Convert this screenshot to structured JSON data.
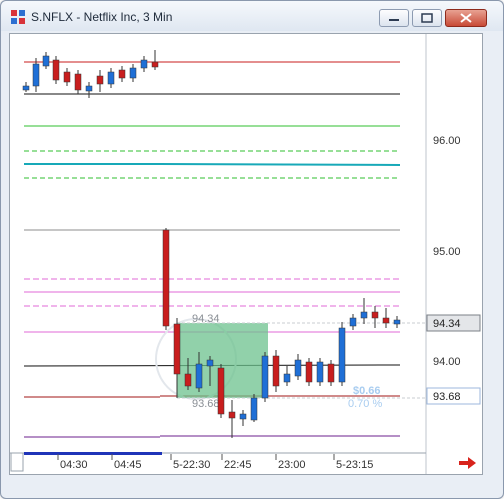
{
  "window": {
    "title": "S.NFLX - Netflix Inc, 3 Min"
  },
  "price_axis": {
    "ticks": [
      "96.00",
      "95.00",
      "94.00"
    ],
    "last_price_badge": "94.34",
    "lower_badge": "93.68"
  },
  "time_axis": {
    "ticks": [
      "04:30",
      "04:45",
      "5-22:30",
      "22:45",
      "23:00",
      "5-23:15"
    ]
  },
  "overlay": {
    "upper_price": "94.34",
    "lower_price": "93.68",
    "change": "$0.66",
    "change_pct": "0.70 %"
  },
  "icons": {
    "app": "grid-icon",
    "minimize": "minimize-icon",
    "maximize": "maximize-icon",
    "close": "close-icon",
    "scroll": "right-arrow-icon"
  },
  "colors": {
    "up_candle": "#1f6fd6",
    "down_candle": "#c81e1e",
    "selection_fill": "#6cc28e"
  }
}
